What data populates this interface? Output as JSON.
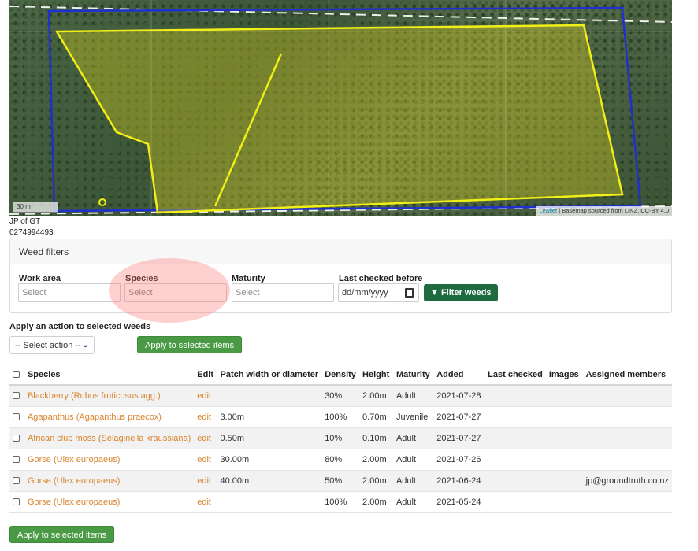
{
  "map": {
    "scale": "30 m",
    "attribution_leaflet": "Leaflet",
    "attribution_rest": " | Basemap sourced from LINZ. CC-BY 4.0"
  },
  "contact": {
    "name": "JP of GT",
    "phone": "0274994493"
  },
  "filters": {
    "title": "Weed filters",
    "work_area": {
      "label": "Work area",
      "placeholder": "Select"
    },
    "species": {
      "label": "Species",
      "placeholder": "Select"
    },
    "maturity": {
      "label": "Maturity",
      "placeholder": "Select"
    },
    "last_checked": {
      "label": "Last checked before",
      "placeholder": "dd/mm/yyyy"
    },
    "button": "Filter weeds"
  },
  "actions": {
    "label": "Apply an action to selected weeds",
    "select_value": "-- Select action --",
    "apply_button": "Apply to selected items",
    "apply_button_bottom": "Apply to selected items"
  },
  "table": {
    "headers": [
      "Species",
      "Edit",
      "Patch width or diameter",
      "Density",
      "Height",
      "Maturity",
      "Added",
      "Last checked",
      "Images",
      "Assigned members"
    ],
    "rows": [
      {
        "species": "Blackberry (Rubus fruticosus agg.)",
        "edit": "edit",
        "patch": "",
        "density": "30%",
        "height": "2.00m",
        "maturity": "Adult",
        "added": "2021-07-28",
        "last_checked": "",
        "images": "",
        "members": ""
      },
      {
        "species": "Agapanthus (Agapanthus praecox)",
        "edit": "edit",
        "patch": "3.00m",
        "density": "100%",
        "height": "0.70m",
        "maturity": "Juvenile",
        "added": "2021-07-27",
        "last_checked": "",
        "images": "",
        "members": ""
      },
      {
        "species": "African club moss (Selaginella kraussiana)",
        "edit": "edit",
        "patch": "0.50m",
        "density": "10%",
        "height": "0.10m",
        "maturity": "Adult",
        "added": "2021-07-27",
        "last_checked": "",
        "images": "",
        "members": ""
      },
      {
        "species": "Gorse (Ulex europaeus)",
        "edit": "edit",
        "patch": "30.00m",
        "density": "80%",
        "height": "2.00m",
        "maturity": "Adult",
        "added": "2021-07-26",
        "last_checked": "",
        "images": "",
        "members": ""
      },
      {
        "species": "Gorse (Ulex europaeus)",
        "edit": "edit",
        "patch": "40.00m",
        "density": "50%",
        "height": "2.00m",
        "maturity": "Adult",
        "added": "2021-06-24",
        "last_checked": "",
        "images": "",
        "members": "jp@groundtruth.co.nz"
      },
      {
        "species": "Gorse (Ulex europaeus)",
        "edit": "edit",
        "patch": "",
        "density": "100%",
        "height": "2.00m",
        "maturity": "Adult",
        "added": "2021-05-24",
        "last_checked": "",
        "images": "",
        "members": ""
      }
    ]
  },
  "colors": {
    "link": "#d8842d",
    "primary_button": "#1d6b3f",
    "apply_button": "#4a9a45",
    "boundary": "#1f2fd0",
    "weed_polygon": "#f2ee17"
  }
}
